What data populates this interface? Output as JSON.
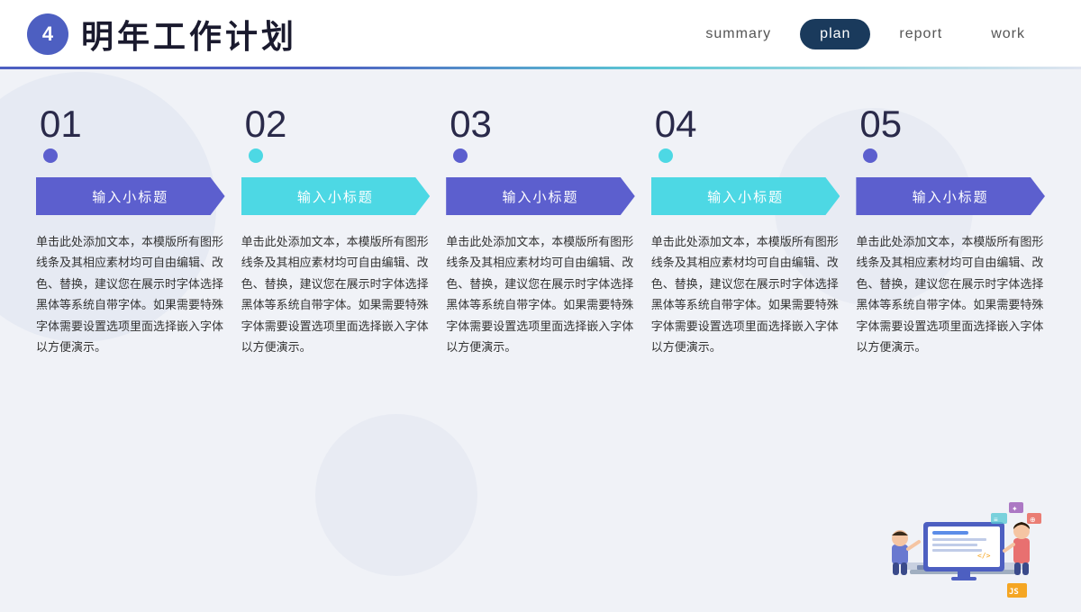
{
  "header": {
    "number": "4",
    "title": "明年工作计划",
    "nav": [
      {
        "label": "summary",
        "active": false
      },
      {
        "label": "plan",
        "active": true
      },
      {
        "label": "report",
        "active": false
      },
      {
        "label": "work",
        "active": false
      }
    ]
  },
  "columns": [
    {
      "number": "01",
      "subtitle": "输入小标题",
      "dot_color": "#5c5fce",
      "banner_color": "#5c5fce",
      "text": "单击此处添加文本，本模版所有图形线条及其相应素材均可自由编辑、改色、替换，建议您在展示时字体选择黑体等系统自带字体。如果需要特殊字体需要设置选项里面选择嵌入字体以方便演示。"
    },
    {
      "number": "02",
      "subtitle": "输入小标题",
      "dot_color": "#4dd8e4",
      "banner_color": "#4dd8e4",
      "text": "单击此处添加文本，本模版所有图形线条及其相应素材均可自由编辑、改色、替换，建议您在展示时字体选择黑体等系统自带字体。如果需要特殊字体需要设置选项里面选择嵌入字体以方便演示。"
    },
    {
      "number": "03",
      "subtitle": "输入小标题",
      "dot_color": "#5c5fce",
      "banner_color": "#5c5fce",
      "text": "单击此处添加文本，本模版所有图形线条及其相应素材均可自由编辑、改色、替换，建议您在展示时字体选择黑体等系统自带字体。如果需要特殊字体需要设置选项里面选择嵌入字体以方便演示。"
    },
    {
      "number": "04",
      "subtitle": "输入小标题",
      "dot_color": "#4dd8e4",
      "banner_color": "#4dd8e4",
      "text": "单击此处添加文本，本模版所有图形线条及其相应素材均可自由编辑、改色、替换，建议您在展示时字体选择黑体等系统自带字体。如果需要特殊字体需要设置选项里面选择嵌入字体以方便演示。"
    },
    {
      "number": "05",
      "subtitle": "输入小标题",
      "dot_color": "#5c5fce",
      "banner_color": "#5c5fce",
      "text": "单击此处添加文本，本模版所有图形线条及其相应素材均可自由编辑、改色、替换，建议您在展示时字体选择黑体等系统自带字体。如果需要特殊字体需要设置选项里面选择嵌入字体以方便演示。"
    }
  ]
}
